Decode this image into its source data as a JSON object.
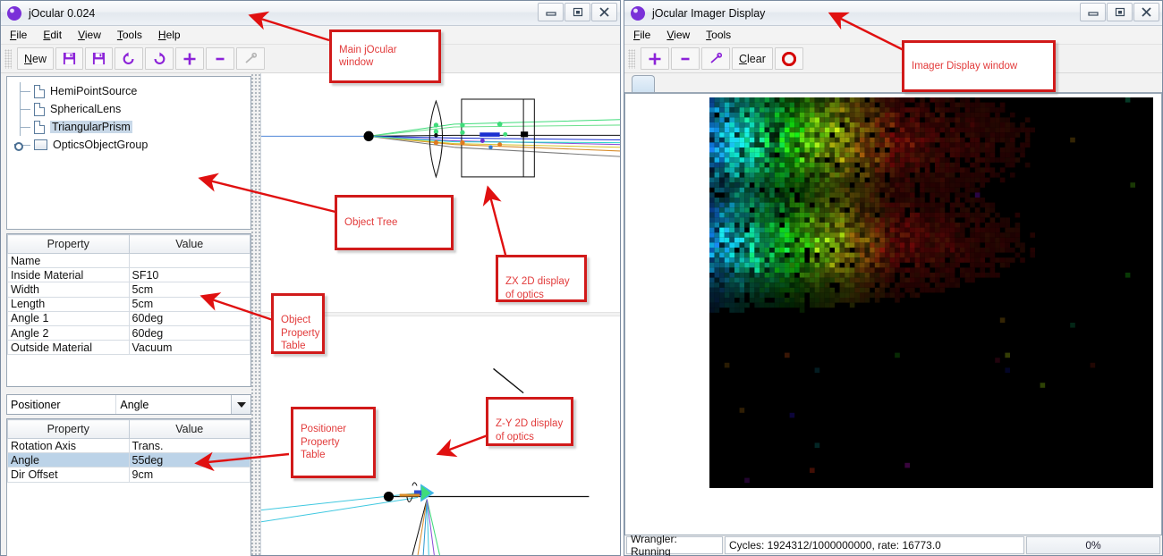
{
  "main_window": {
    "title": "jOcular 0.024",
    "icon": "jocular-logo-icon",
    "window_buttons": {
      "minimize": "—",
      "restore": "❐",
      "close": "✕"
    },
    "menus": [
      {
        "label": "File",
        "mnemonic": "F"
      },
      {
        "label": "Edit",
        "mnemonic": "E"
      },
      {
        "label": "View",
        "mnemonic": "V"
      },
      {
        "label": "Tools",
        "mnemonic": "T"
      },
      {
        "label": "Help",
        "mnemonic": "H"
      }
    ],
    "toolbar": [
      {
        "name": "new-button",
        "label": "New",
        "kind": "text",
        "enabled": true
      },
      {
        "name": "save-button",
        "label": "💾",
        "kind": "icon",
        "enabled": true
      },
      {
        "name": "save-as-button",
        "label": "💾",
        "kind": "icon",
        "enabled": true
      },
      {
        "name": "undo-button",
        "label": "↺",
        "kind": "icon",
        "enabled": true
      },
      {
        "name": "redo-button",
        "label": "↻",
        "kind": "icon",
        "enabled": true
      },
      {
        "name": "add-button",
        "label": "+",
        "kind": "icon",
        "enabled": true
      },
      {
        "name": "remove-button",
        "label": "-",
        "kind": "icon",
        "enabled": true
      },
      {
        "name": "connect-button",
        "label": "✐",
        "kind": "icon",
        "enabled": false
      }
    ],
    "tree": {
      "items": [
        {
          "label": "HemiPointSource",
          "icon": "document-icon",
          "selected": false,
          "expandable": false
        },
        {
          "label": "SphericalLens",
          "icon": "document-icon",
          "selected": false,
          "expandable": false
        },
        {
          "label": "TriangularPrism",
          "icon": "document-icon",
          "selected": true,
          "expandable": false
        },
        {
          "label": "OpticsObjectGroup",
          "icon": "folder-icon",
          "selected": false,
          "expandable": true
        }
      ]
    },
    "object_property_table": {
      "headers": [
        "Property",
        "Value"
      ],
      "rows": [
        {
          "property": "Name",
          "value": "",
          "selected": false
        },
        {
          "property": "Inside Material",
          "value": "SF10",
          "selected": false
        },
        {
          "property": "Width",
          "value": "5cm",
          "selected": false
        },
        {
          "property": "Length",
          "value": "5cm",
          "selected": false
        },
        {
          "property": "Angle 1",
          "value": "60deg",
          "selected": false
        },
        {
          "property": "Angle 2",
          "value": "60deg",
          "selected": false
        },
        {
          "property": "Outside Material",
          "value": "Vacuum",
          "selected": false
        }
      ]
    },
    "positioner": {
      "label": "Positioner",
      "selected_option": "Angle",
      "options": [
        "Angle"
      ]
    },
    "positioner_property_table": {
      "headers": [
        "Property",
        "Value"
      ],
      "rows": [
        {
          "property": "Rotation Axis",
          "value": "Trans.",
          "selected": false
        },
        {
          "property": "Angle",
          "value": "55deg",
          "selected": true
        },
        {
          "property": "Dir Offset",
          "value": "9cm",
          "selected": false
        }
      ]
    }
  },
  "imager_window": {
    "title": "jOcular Imager Display",
    "icon": "jocular-logo-icon",
    "window_buttons": {
      "minimize": "—",
      "restore": "❐",
      "close": "✕"
    },
    "menus": [
      {
        "label": "File",
        "mnemonic": "F"
      },
      {
        "label": "View",
        "mnemonic": "V"
      },
      {
        "label": "Tools",
        "mnemonic": "T"
      }
    ],
    "toolbar": [
      {
        "name": "zoom-in-button",
        "label": "+",
        "kind": "icon",
        "enabled": true
      },
      {
        "name": "zoom-out-button",
        "label": "-",
        "kind": "icon",
        "enabled": true
      },
      {
        "name": "connect-button",
        "label": "✐",
        "kind": "icon",
        "enabled": true
      },
      {
        "name": "clear-button",
        "label": "Clear",
        "kind": "text",
        "enabled": true
      },
      {
        "name": "stop-button",
        "label": "⬤",
        "kind": "stop",
        "enabled": true
      }
    ],
    "tab": {
      "label": ""
    },
    "status": {
      "wrangler": "Wrangler: Running",
      "cycles": "Cycles: 1924312/1000000000, rate: 16773.0",
      "progress_label": "0%",
      "progress_percent": 0
    }
  },
  "annotations": [
    {
      "name": "annotation-main-window",
      "text": "Main jOcular window"
    },
    {
      "name": "annotation-object-tree",
      "text": "Object Tree"
    },
    {
      "name": "annotation-zx-display",
      "text": "ZX 2D display of optics"
    },
    {
      "name": "annotation-object-property-table",
      "text": "Object\nProperty\nTable"
    },
    {
      "name": "annotation-positioner-property-table",
      "text": "Positioner\nProperty Table"
    },
    {
      "name": "annotation-zy-display",
      "text": "Z-Y 2D display of optics"
    },
    {
      "name": "annotation-imager-window",
      "text": "Imager Display window"
    }
  ],
  "colors": {
    "annotation_border": "#d11a1a",
    "annotation_text": "#e23b3b",
    "toolbar_icon": "#7a1fd0",
    "selection": "#bcd3e8",
    "stop_button": "#d40000"
  }
}
